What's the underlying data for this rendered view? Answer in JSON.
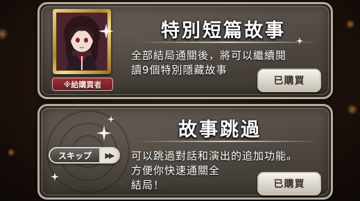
{
  "special_story": {
    "title": "特別短篇故事",
    "description": [
      "全部結局通關後，將可以繼續閱",
      "讀9個特別隱藏故事"
    ],
    "badge": "※給購買者",
    "button": "已購買"
  },
  "skip_feature": {
    "title": "故事跳過",
    "skip_pill_label": "スキップ",
    "skip_pill_icon": "fast-forward-icon",
    "description": [
      "可以跳過對話和演出的追加功能。",
      "方便你快速通關全",
      "結局！"
    ],
    "button": "已購買"
  },
  "colors": {
    "panel": "#4a433d",
    "panel_border": "#b8ad9a",
    "badge": "#8a2830",
    "button": "#ece8e0",
    "portrait_frame": "#d4a84c"
  }
}
